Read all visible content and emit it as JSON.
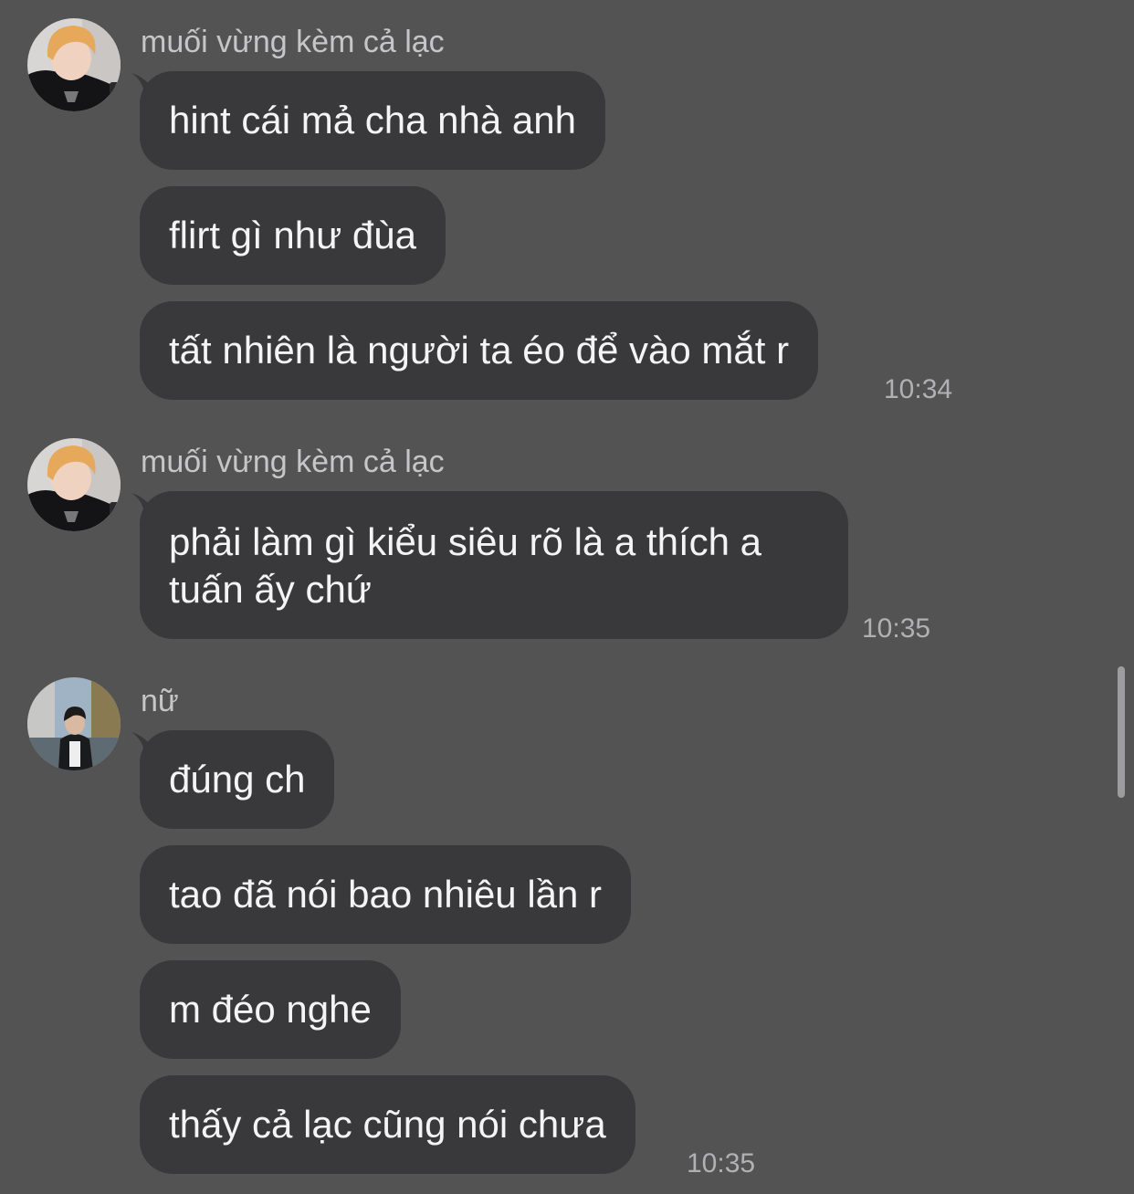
{
  "groups": [
    {
      "sender": "muối vừng kèm cả lạc",
      "avatar_icon": "user-avatar-blond-icon",
      "messages": [
        "hint cái mả cha nhà anh",
        "flirt gì như đùa",
        "tất nhiên là người ta éo để vào mắt r"
      ],
      "time": "10:34"
    },
    {
      "sender": "muối vừng kèm cả lạc",
      "avatar_icon": "user-avatar-blond-icon",
      "messages": [
        "phải làm gì kiểu siêu rõ là a thích a tuấn ấy chứ"
      ],
      "time": "10:35"
    },
    {
      "sender": "nữ",
      "avatar_icon": "user-avatar-street-icon",
      "messages": [
        "đúng ch",
        "tao đã nói bao nhiêu lần r",
        "m đéo nghe",
        "thấy cả lạc cũng nói chưa"
      ],
      "time": "10:35"
    }
  ],
  "colors": {
    "background": "#545354",
    "bubble": "#39383a",
    "message_text": "#f4f3f5",
    "sender_text": "#c6c5c7",
    "time_text": "#b1b0b2"
  }
}
